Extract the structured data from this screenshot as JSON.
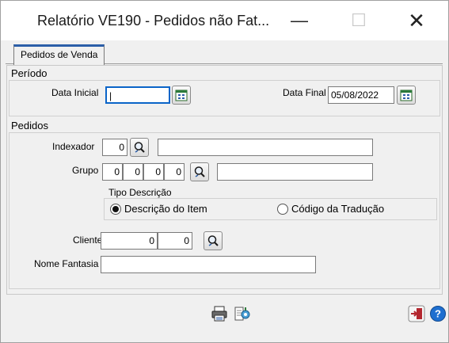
{
  "window": {
    "title": "Relatório VE190 - Pedidos não Fat...",
    "minimize_glyph": "—",
    "maximize_glyph": "☐",
    "close_glyph": "✕"
  },
  "tabs": [
    {
      "label": "Pedidos de Venda",
      "active": true
    }
  ],
  "periodo": {
    "title": "Período",
    "data_inicial_label": "Data Inicial",
    "data_inicial_value": "|",
    "data_final_label": "Data Final",
    "data_final_value": "05/08/2022"
  },
  "pedidos": {
    "title": "Pedidos",
    "indexador_label": "Indexador",
    "indexador_value": "0",
    "indexador_desc": "",
    "grupo_label": "Grupo",
    "grupo_values": [
      "0",
      "0",
      "0",
      "0"
    ],
    "grupo_desc": "",
    "tipo_descricao": {
      "title": "Tipo Descrição",
      "options": [
        {
          "label": "Descrição do Item",
          "selected": true
        },
        {
          "label": "Código da Tradução",
          "selected": false
        }
      ]
    },
    "cliente_label": "Cliente",
    "cliente_value1": "0",
    "cliente_value2": "0",
    "nome_fantasia_label": "Nome Fantasia",
    "nome_fantasia_value": ""
  },
  "icons": {
    "calendar": "calendar-icon",
    "search": "search-icon",
    "print": "printer-icon",
    "config": "settings-icon",
    "exit": "exit-icon",
    "help": "help-icon"
  },
  "colors": {
    "accent": "#2b5ea8",
    "focus": "#0a64c8",
    "exit_red": "#b3262e",
    "help_blue": "#1e6fd0"
  },
  "help_glyph": "?"
}
